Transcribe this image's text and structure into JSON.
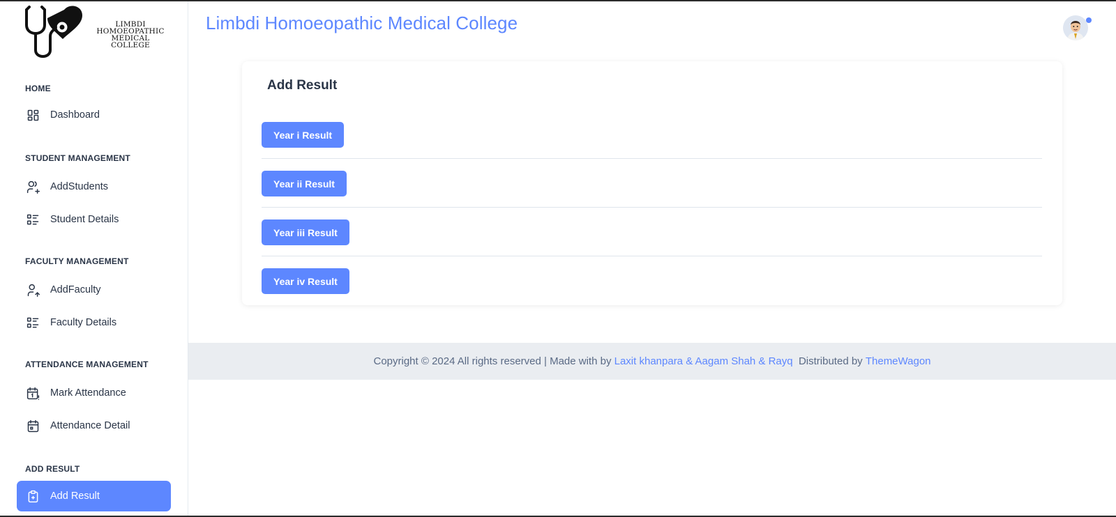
{
  "brand": {
    "logo_lines": [
      "LIMBDI",
      "HOMOEOPATHIC",
      "MEDICAL COLLEGE"
    ]
  },
  "header": {
    "title": "Limbdi Homoeopathic Medical College"
  },
  "sidebar": {
    "sections": [
      {
        "label": "HOME"
      },
      {
        "label": "STUDENT MANAGEMENT"
      },
      {
        "label": "FACULTY MANAGEMENT"
      },
      {
        "label": "ATTENDANCE MANAGEMENT"
      },
      {
        "label": "ADD RESULT"
      }
    ],
    "items": [
      {
        "label": "Dashboard",
        "icon": "dashboard-icon"
      },
      {
        "label": "AddStudents",
        "icon": "user-plus-icon"
      },
      {
        "label": "Student Details",
        "icon": "list-details-icon"
      },
      {
        "label": "AddFaculty",
        "icon": "user-up-icon"
      },
      {
        "label": "Faculty Details",
        "icon": "list-details-icon"
      },
      {
        "label": "Mark Attendance",
        "icon": "calendar-exclamation-icon"
      },
      {
        "label": "Attendance Detail",
        "icon": "calendar-icon"
      },
      {
        "label": "Add Result",
        "icon": "clipboard-plus-icon",
        "active": true
      }
    ]
  },
  "card": {
    "title": "Add Result",
    "buttons": [
      {
        "label": "Year i Result"
      },
      {
        "label": "Year ii Result"
      },
      {
        "label": "Year iii Result"
      },
      {
        "label": "Year iv Result"
      }
    ]
  },
  "footer": {
    "prefix": "Copyright © 2024 All rights reserved | Made with by ",
    "authors_link": "Laxit khanpara & Aagam Shah & Rayq",
    "distributed": "  Distributed by ",
    "distributor_link": "ThemeWagon"
  },
  "colors": {
    "accent": "#5d87ff",
    "text": "#2a3547",
    "footer_bg": "#eaedf1"
  }
}
